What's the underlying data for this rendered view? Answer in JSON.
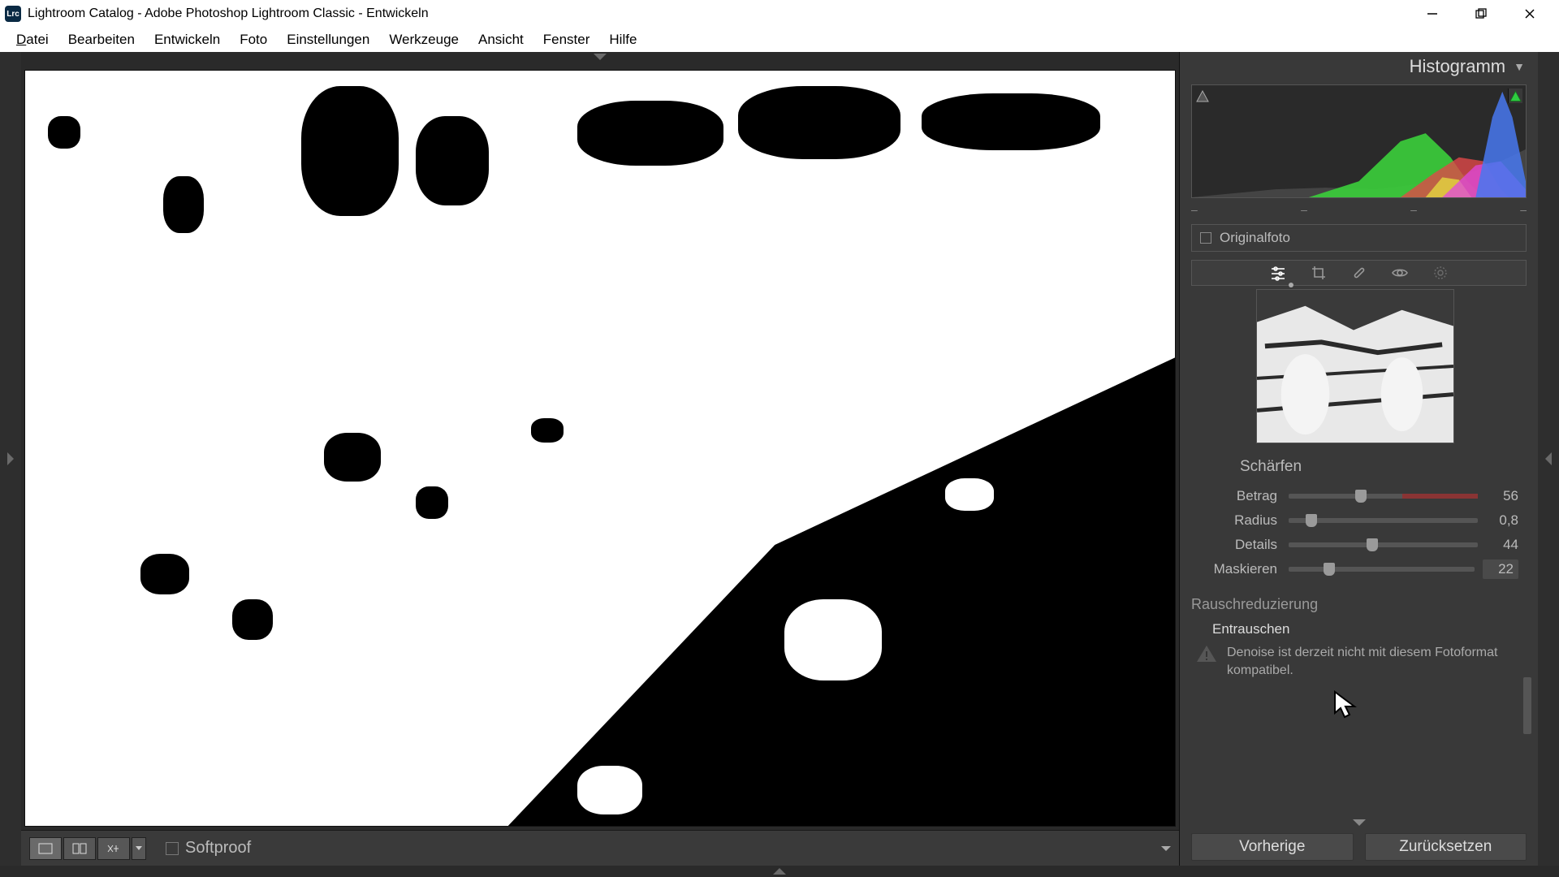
{
  "titlebar": {
    "appIconText": "Lrc",
    "title": "Lightroom Catalog - Adobe Photoshop Lightroom Classic - Entwickeln"
  },
  "menu": {
    "items": [
      "Datei",
      "Bearbeiten",
      "Entwickeln",
      "Foto",
      "Einstellungen",
      "Werkzeuge",
      "Ansicht",
      "Fenster",
      "Hilfe"
    ]
  },
  "footer": {
    "softproofLabel": "Softproof"
  },
  "right": {
    "histLabel": "Histogramm",
    "stats": [
      "–",
      "–",
      "–",
      "–"
    ],
    "originalLabel": "Originalfoto",
    "tools": [
      "sliders-icon",
      "crop-icon",
      "heal-icon",
      "redeye-icon",
      "radial-icon"
    ],
    "sharpen": {
      "title": "Schärfen",
      "rows": [
        {
          "label": "Betrag",
          "value": "56",
          "pos": 38,
          "accent": true
        },
        {
          "label": "Radius",
          "value": "0,8",
          "pos": 12,
          "accent": false
        },
        {
          "label": "Details",
          "value": "44",
          "pos": 44,
          "accent": false
        },
        {
          "label": "Maskieren",
          "value": "22",
          "pos": 22,
          "accent": false,
          "active": true
        }
      ]
    },
    "noise": {
      "title": "Rauschreduzierung",
      "denoise": "Entrauschen",
      "warn": "Denoise ist derzeit nicht mit diesem Fotoformat kompatibel."
    },
    "buttons": {
      "prev": "Vorherige",
      "reset": "Zurücksetzen"
    }
  }
}
